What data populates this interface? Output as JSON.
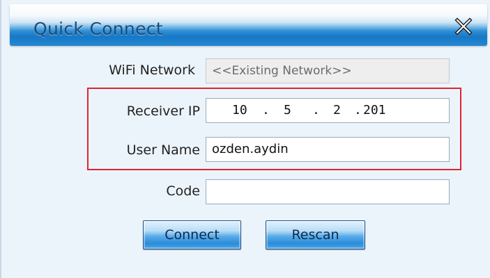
{
  "window": {
    "title": "Quick Connect",
    "close_icon": "close-x-icon"
  },
  "form": {
    "wifi_network": {
      "label": "WiFi Network",
      "value": "<<Existing Network>>"
    },
    "receiver_ip": {
      "label": "Receiver IP",
      "octets": [
        "10",
        "5",
        "2",
        "201"
      ]
    },
    "user_name": {
      "label": "User Name",
      "value": "ozden.aydin"
    },
    "code": {
      "label": "Code",
      "value": ""
    }
  },
  "buttons": {
    "connect_label": "Connect",
    "rescan_label": "Rescan"
  },
  "colors": {
    "title_bar_blue": "#1778c6",
    "highlight_red": "#e0242f",
    "dialog_bg": "#ecf4fb"
  }
}
